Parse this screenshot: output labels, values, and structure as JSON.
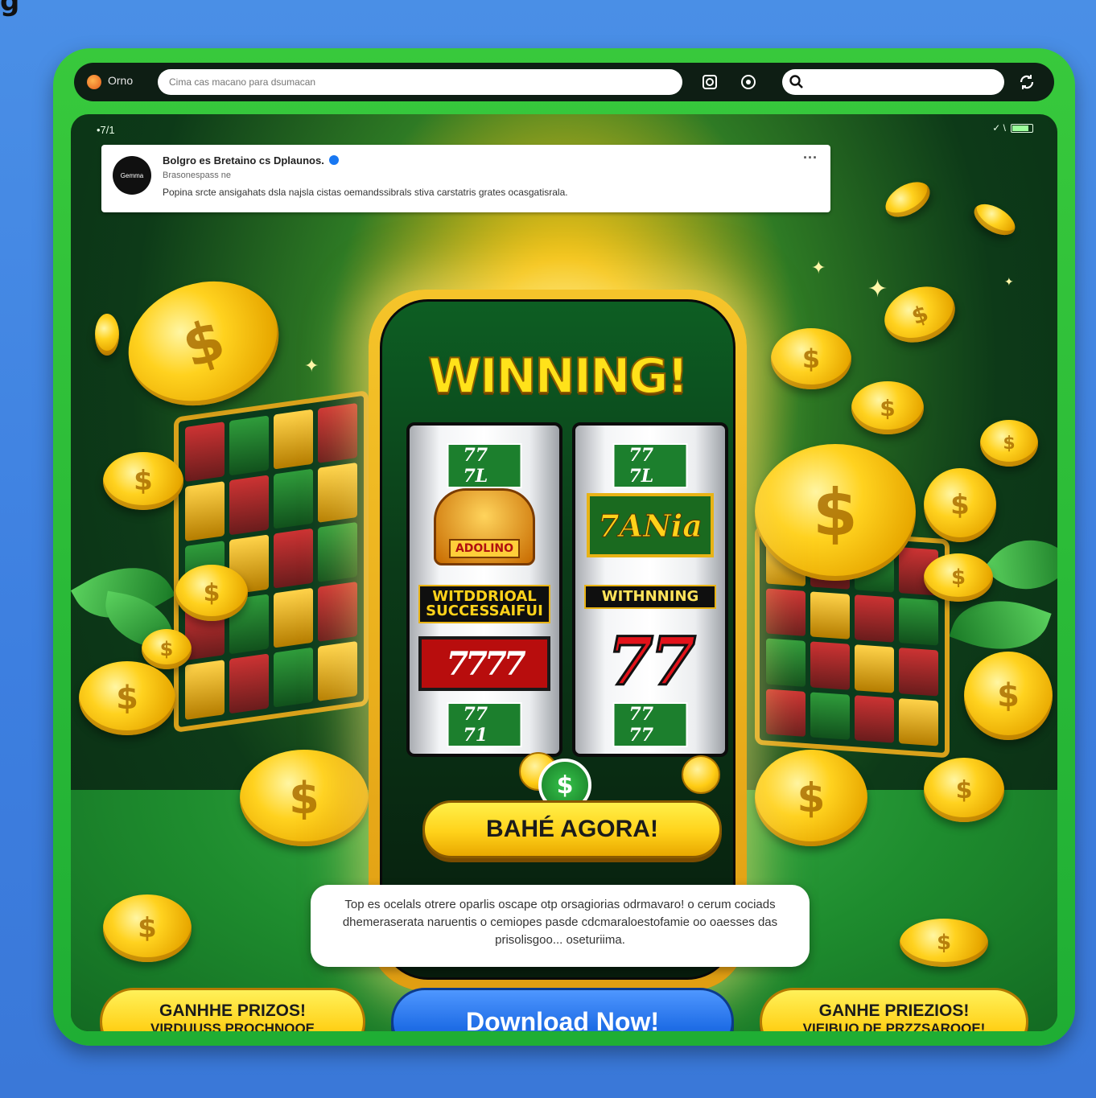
{
  "browser": {
    "tab_name": "Orno",
    "url_placeholder": "Cima cas macano para dsumacan",
    "search_placeholder": ""
  },
  "status_bar": {
    "left": "•7/1",
    "right": "✓ \\"
  },
  "post": {
    "avatar_text": "Gemma",
    "author": "Bolgro es Bretaino cs Dplaunos.",
    "subtitle": "Brasonespass ne",
    "body": "Popina srcte ansigahats dsla najsla cistas oemandssibrals stiva carstatris grates ocasgatisrala."
  },
  "game": {
    "headline": "WINNING!",
    "reel1": {
      "top_tag": "77 7L",
      "badge_label": "ADOLINO",
      "label": "WITDDRIOAL SUCCESSAIFUI",
      "sevens": "7777",
      "bottom_tag": "77 71"
    },
    "reel2": {
      "top_tag": "77 7L",
      "box_text": "7ANia",
      "label": "WITHNNING",
      "sevens": "77",
      "bottom_tag": "77 77"
    },
    "dollar_symbol": "$",
    "bet_button": "BAHÉ AGORA!"
  },
  "info_text": "Top es ocelals otrere oparlis oscape otp orsagiorias odrmavaro! o cerum cociads dhemeraserata naruentis o cemiopes pasde cdcmaraloestofamie oo oaesses das prisolisgoo... oseturiima.",
  "cta_left": {
    "line1": "GANHHE PRIZOS!",
    "line2": "VIRDUUSS PROCHNOOE"
  },
  "cta_center": "Download Now!",
  "cta_right": {
    "line1": "GANHE PRIEZIOS!",
    "line2": "VIEIBUO DE PRZZSAROOE!"
  },
  "coin_symbol": "$",
  "colors": {
    "frame_green": "#1fae34",
    "gold": "#ffd21a",
    "cta_blue": "#1f6de6"
  }
}
